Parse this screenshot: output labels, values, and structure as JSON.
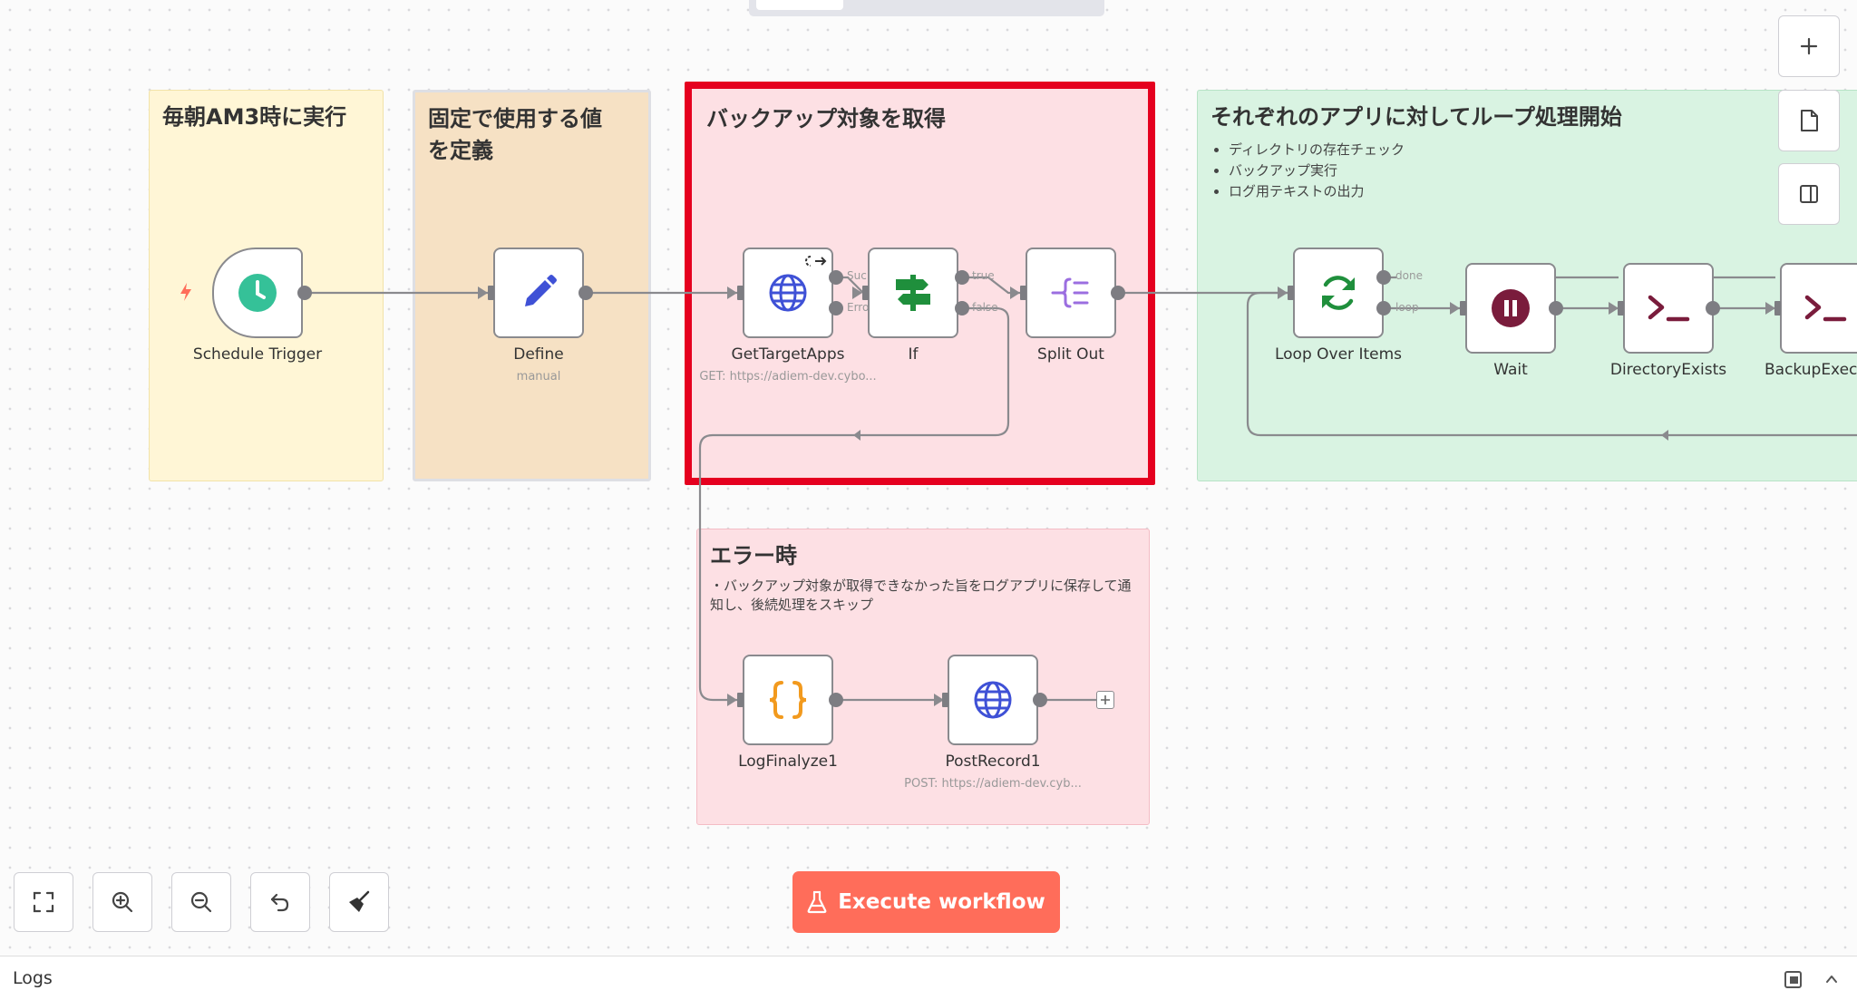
{
  "stickies": [
    {
      "title": "毎朝AM3時に実行",
      "color": "#fff6d6"
    },
    {
      "title": "固定で使用する値\nを定義",
      "color": "#f6e1c4"
    },
    {
      "title": "バックアップ対象を取得",
      "color": "#fde0e4"
    },
    {
      "title": "それぞれのアプリに対してループ処理開始",
      "color": "#d9f3e2",
      "bullets": [
        "ディレクトリの存在チェック",
        "バックアップ実行",
        "ログ用テキストの出力"
      ]
    },
    {
      "title": "エラー時",
      "color": "#fde0e4",
      "text": "・バックアップ対象が取得できなかった旨をログアプリに保存して通\n知し、後続処理をスキップ"
    }
  ],
  "nodes": {
    "schedule_trigger": {
      "label": "Schedule Trigger",
      "icon": "clock-icon"
    },
    "define": {
      "label": "Define",
      "sub": "manual",
      "icon": "pencil-icon"
    },
    "get_target_apps": {
      "label": "GetTargetApps",
      "sub": "GET: https://adiem-dev.cybo...",
      "icon": "globe-icon"
    },
    "if": {
      "label": "If",
      "icon": "signpost-icon"
    },
    "split_out": {
      "label": "Split Out",
      "icon": "split-icon"
    },
    "loop_over_items": {
      "label": "Loop Over Items",
      "icon": "refresh-icon"
    },
    "wait": {
      "label": "Wait",
      "icon": "pause-icon"
    },
    "directory_exists": {
      "label": "DirectoryExists",
      "icon": "terminal-icon"
    },
    "backup_exec": {
      "label": "BackupExec",
      "icon": "terminal-icon"
    },
    "log_finalyze": {
      "label": "LogFinalyze1",
      "icon": "braces-icon"
    },
    "post_record": {
      "label": "PostRecord1",
      "sub": "POST: https://adiem-dev.cyb...",
      "icon": "globe-icon"
    }
  },
  "ports": {
    "success": "Suc",
    "error": "Erro",
    "true": "true",
    "false": "false",
    "done": "done",
    "loop": "loop"
  },
  "toolbar": {
    "execute_label": "Execute workflow"
  },
  "logs": {
    "label": "Logs"
  },
  "colors": {
    "accent": "#ff6d5a",
    "highlight": "#e5001f"
  }
}
